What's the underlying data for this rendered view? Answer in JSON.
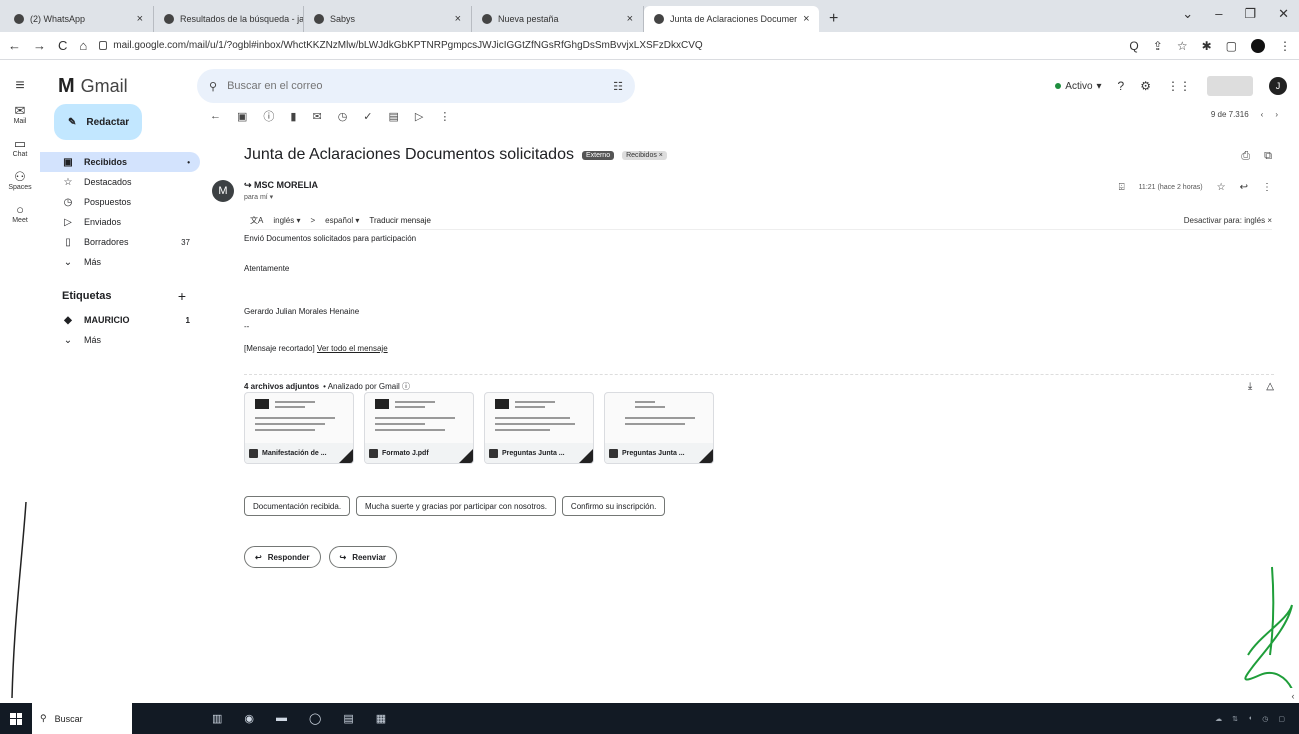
{
  "browser": {
    "tabs": [
      {
        "label": "(2) WhatsApp"
      },
      {
        "label": "Resultados de la búsqueda - jai"
      },
      {
        "label": "Sabys"
      },
      {
        "label": "Nueva pestaña"
      },
      {
        "label": "Junta de Aclaraciones Documer"
      }
    ],
    "new_tab": "+",
    "url": "mail.google.com/mail/u/1/?ogbl#inbox/WhctKKZNzMlw/bLWJdkGbKPTNRPgmpcsJWJicIGGtZfNGsRfGhgDsSmBvvjxLXSFzDkxCVQ"
  },
  "gmail": {
    "logo_text": "Gmail",
    "search_placeholder": "Buscar en el correo",
    "status": "Activo",
    "avatar_letter": "J"
  },
  "rail": [
    {
      "label": "Mail"
    },
    {
      "label": "Chat"
    },
    {
      "label": "Spaces"
    },
    {
      "label": "Meet"
    }
  ],
  "nav": {
    "compose": "Redactar",
    "items": [
      {
        "label": "Recibidos",
        "count": "•"
      },
      {
        "label": "Destacados",
        "count": ""
      },
      {
        "label": "Pospuestos",
        "count": ""
      },
      {
        "label": "Enviados",
        "count": ""
      },
      {
        "label": "Borradores",
        "count": "37"
      },
      {
        "label": "Más",
        "count": ""
      }
    ],
    "labels_title": "Etiquetas",
    "labels": [
      {
        "label": "MAURICIO",
        "count": "1"
      },
      {
        "label": "Más",
        "count": ""
      }
    ]
  },
  "message": {
    "pager": "9 de 7.316",
    "subject": "Junta de Aclaraciones Documentos solicitados",
    "chip_external": "Externo",
    "chip_inbox": "Recibidos ×",
    "sender_initial": "M",
    "sender_name": "MSC MORELIA",
    "to": "para mí ▾",
    "time": "11:21 (hace 2 horas)",
    "translate_from": "inglés ▾",
    "translate_arrow": ">",
    "translate_to": "español ▾",
    "translate_action": "Traducir mensaje",
    "translate_off": "Desactivar para: inglés ×",
    "body_line1": "Envió Documentos solicitados para participación",
    "body_line2": "Atentamente",
    "body_line3": "Gerardo Julian Morales Henaine",
    "body_line4": "--",
    "clipped": "[Mensaje recortado]",
    "view_all": "Ver todo el mensaje",
    "attach_count": "4 archivos adjuntos",
    "attach_scan": "• Analizado por Gmail ⓘ",
    "attachments": [
      {
        "name": "Manifestación de ..."
      },
      {
        "name": "Formato J.pdf"
      },
      {
        "name": "Preguntas Junta ..."
      },
      {
        "name": "Preguntas Junta ..."
      }
    ],
    "smart_replies": [
      {
        "label": "Documentación recibida."
      },
      {
        "label": "Mucha suerte y gracias por participar con nosotros."
      },
      {
        "label": "Confirmo su inscripción."
      }
    ],
    "reply": "Responder",
    "forward": "Reenviar"
  },
  "taskbar": {
    "search": "Buscar"
  }
}
